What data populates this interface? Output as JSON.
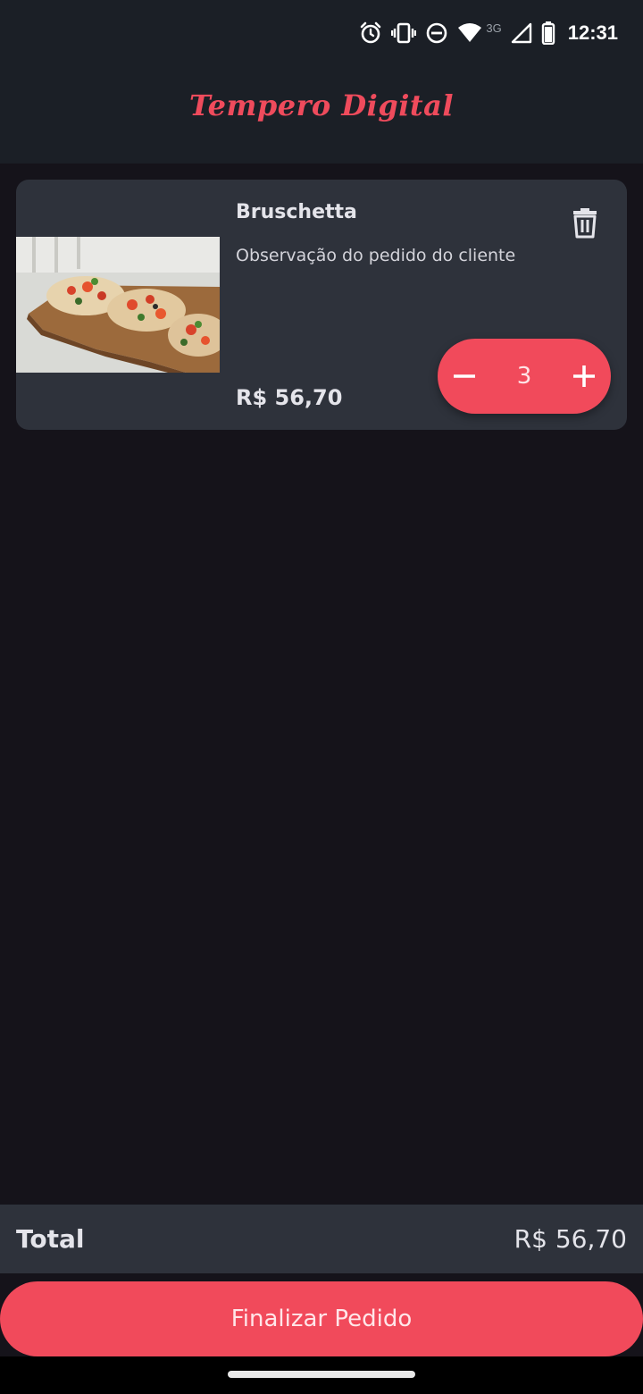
{
  "status_bar": {
    "time": "12:31",
    "network_type": "3G",
    "icons": [
      "alarm-icon",
      "vibrate-icon",
      "do-not-disturb-icon",
      "wifi-icon",
      "signal-icon",
      "battery-icon"
    ]
  },
  "app_bar": {
    "title": "Tempero Digital",
    "title_color": "#ef4b5c"
  },
  "cart": {
    "items": [
      {
        "name": "Bruschetta",
        "note": "Observação do pedido do cliente",
        "price": "R$ 56,70",
        "quantity": "3",
        "image": "bruschetta-photo",
        "delete_icon": "trash-icon",
        "decrement_icon": "minus-icon",
        "increment_icon": "plus-icon"
      }
    ]
  },
  "summary": {
    "total_label": "Total",
    "total_value": "R$ 56,70"
  },
  "checkout": {
    "label": "Finalizar Pedido"
  },
  "colors": {
    "accent": "#f14a5b",
    "background": "#15131a",
    "card": "#2e323b",
    "header": "#1b1f26"
  }
}
